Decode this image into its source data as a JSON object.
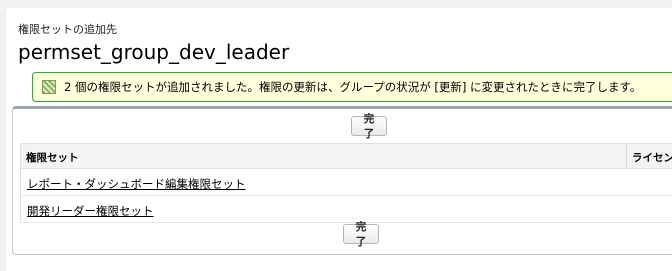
{
  "header": {
    "eyebrow": "権限セットの追加先",
    "title": "permset_group_dev_leader"
  },
  "banner": {
    "icon": "success-message-icon",
    "message": "2 個の権限セットが追加されました。権限の更新は、グループの状況が [更新] に変更されたときに完了します。"
  },
  "panel": {
    "done_top": "完了",
    "done_bottom": "完了",
    "columns": [
      "権限セット",
      "ライセンス"
    ],
    "rows": [
      {
        "name": "レポート・ダッシュボード編集権限セット"
      },
      {
        "name": "開発リーダー権限セット"
      }
    ]
  }
}
